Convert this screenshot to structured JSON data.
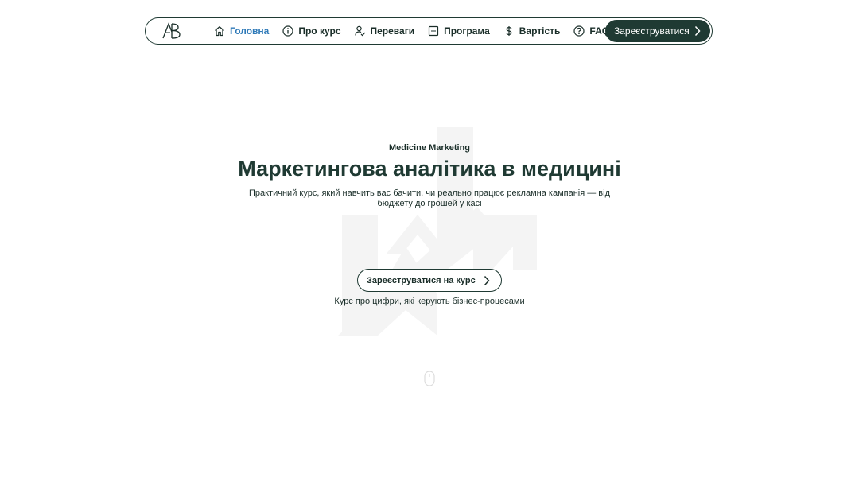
{
  "nav": {
    "logo_text": "AB",
    "items": [
      {
        "label": "Головна",
        "icon": "home-icon",
        "active": true
      },
      {
        "label": "Про курс",
        "icon": "info-icon",
        "active": false
      },
      {
        "label": "Переваги",
        "icon": "user-check-icon",
        "active": false
      },
      {
        "label": "Програма",
        "icon": "program-icon",
        "active": false
      },
      {
        "label": "Вартість",
        "icon": "dollar-icon",
        "active": false
      },
      {
        "label": "FAQ",
        "icon": "question-icon",
        "active": false
      }
    ],
    "cta_label": "Зареєструватися"
  },
  "hero": {
    "eyebrow": "Medicine Marketing",
    "title": "Маркетингова аналітика в медицині",
    "subtitle": "Практичний курс, який навчить вас бачити, чи реально працює рекламна кампанія — від бюджету до грошей у касі",
    "button_label": "Зареєструватися на курс",
    "tagline": "Курс про цифри, які керують бізнес-процесами"
  },
  "colors": {
    "primary": "#1f3a33",
    "active_link": "#2f7ab8",
    "background": "#ffffff",
    "watermark": "#f3f3f3"
  }
}
